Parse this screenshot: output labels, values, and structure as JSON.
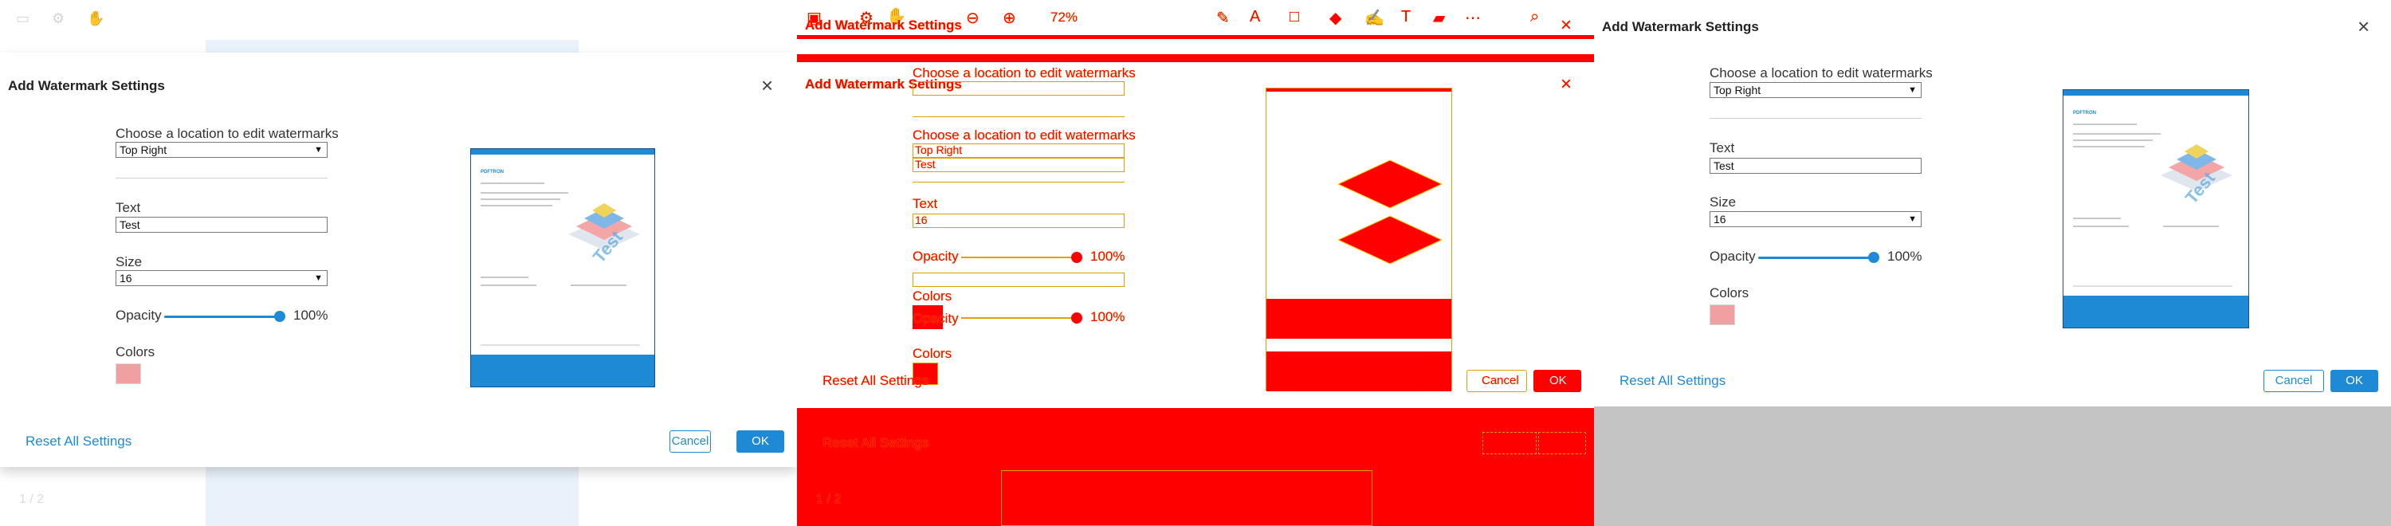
{
  "dialog": {
    "title": "Add Watermark Settings",
    "location_label": "Choose a location to edit watermarks",
    "location_value": "Top Right",
    "text_label": "Text",
    "text_value": "Test",
    "size_label": "Size",
    "size_value": "16",
    "opacity_label": "Opacity",
    "opacity_value": "100%",
    "opacity_level": 1.0,
    "colors_label": "Colors",
    "color_swatch": "#f0a0a0",
    "reset_label": "Reset All Settings",
    "cancel_label": "Cancel",
    "ok_label": "OK",
    "close_icon": "close-icon",
    "arrow_icon": "chevron-down-icon"
  },
  "toolbar": {
    "zoom": "72%",
    "icons": [
      "sidebar-icon",
      "settings-icon",
      "hand-icon",
      "zoom-out-icon",
      "zoom-in-icon",
      "pen-icon",
      "text-color-icon",
      "shape-icon",
      "eraser-icon",
      "signature-icon",
      "text-icon",
      "comment-icon",
      "search-icon",
      "more-icon"
    ]
  },
  "viewer": {
    "page_indicator": "1 / 2"
  },
  "thumbnail": {
    "logo": "PDFTRON",
    "watermark": "Test"
  },
  "colors": {
    "accent": "#1e8ad6",
    "diff_red": "#ff0000",
    "diff_yellow": "#ffd400",
    "grey": "#c4c4c4"
  }
}
